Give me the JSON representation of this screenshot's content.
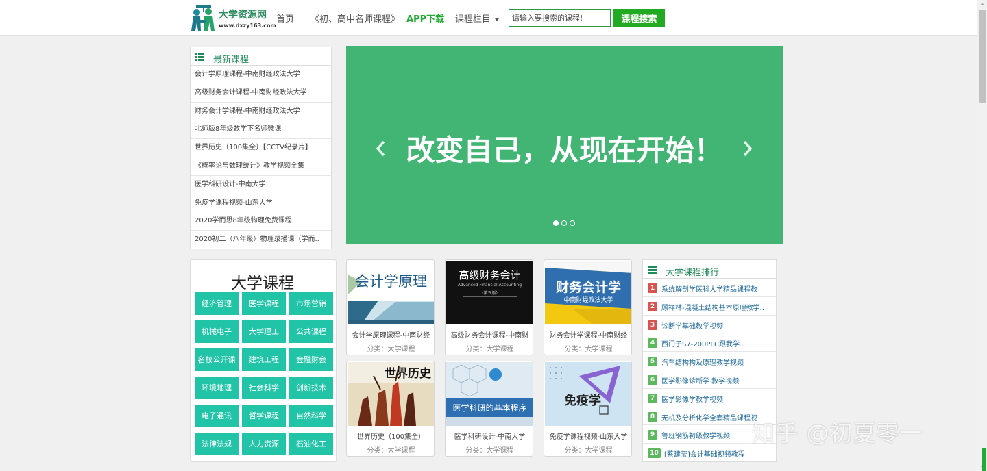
{
  "header": {
    "logo_title": "大学资源网",
    "logo_url": "www.dxzy163.com",
    "nav": {
      "home": "首页",
      "teachers": "《初、高中名师课程》",
      "app": "APP下载",
      "columns": "课程栏目"
    },
    "search_placeholder": "请输入要搜索的课程!",
    "search_button": "课程搜索"
  },
  "latest": {
    "title": "最新课程",
    "items": [
      "会计学原理课程-中南财经政法大学",
      "高级财务会计课程-中南财经政法大学",
      "财务会计学课程-中南财经政法大学",
      "北师版8年级数学下名师微课",
      "世界历史（100集全）【CCTV纪录片】",
      "《概率论与数理统计》教学视频全集",
      "医学科研设计-中南大学",
      "免疫学课程视频-山东大学",
      "2020学而思8年级物理免费课程",
      "2020初二（八年级）物理录播课（学而.."
    ]
  },
  "banner": {
    "text": "改变自己，从现在开始！",
    "color": "#42b574"
  },
  "categories": {
    "title": "大学课程",
    "items": [
      "经济管理",
      "医学课程",
      "市场营销",
      "机械电子",
      "大学理工",
      "公共课程",
      "名校公开课",
      "建筑工程",
      "金融财会",
      "环境地理",
      "社会科学",
      "创新技术",
      "电子通讯",
      "哲学课程",
      "自然科学",
      "法律法规",
      "人力资源",
      "石油化工"
    ]
  },
  "courses": [
    {
      "name": "会计学原理课程-中南财经",
      "cat": "分类：大学课程",
      "cover": "会计学原理"
    },
    {
      "name": "高级财务会计课程-中南财",
      "cat": "分类：大学课程",
      "cover": "高级财务会计",
      "cover_sub": "Advanced Financial Accounting",
      "cover_ed": "（第五版）"
    },
    {
      "name": "财务会计学课程-中南财经",
      "cat": "分类：大学课程",
      "cover": "财务会计学",
      "cover_sub": "中南财经政法大学"
    },
    {
      "name": "世界历史（100集全）",
      "cat": "分类：大学课程",
      "cover": "世界历史"
    },
    {
      "name": "医学科研设计-中南大学",
      "cat": "分类：大学课程",
      "cover": "医学科研的基本程序"
    },
    {
      "name": "免疫学课程视频-山东大学",
      "cat": "分类：大学课程",
      "cover": "免疫学"
    }
  ],
  "ranking": {
    "title": "大学课程排行",
    "items": [
      {
        "num": "1",
        "text": "系统解剖学医科大学精品课程教"
      },
      {
        "num": "2",
        "text": "顾祥林-混凝土结构基本原理教学.."
      },
      {
        "num": "3",
        "text": "诊断学基础教学视频"
      },
      {
        "num": "4",
        "text": "西门子S7-200PLC跟我学.."
      },
      {
        "num": "5",
        "text": "汽车结构构及原理教学视频"
      },
      {
        "num": "6",
        "text": "医学影像诊断学 教学视频"
      },
      {
        "num": "7",
        "text": "医学影像学教学视频"
      },
      {
        "num": "8",
        "text": "无机及分析化学全套精品课程视"
      },
      {
        "num": "9",
        "text": "鲁班钢筋初级教学视频"
      },
      {
        "num": "10",
        "text": "[蔡建莹]会计基础视频教程"
      }
    ],
    "badge_colors": {
      "top": "#d9534f",
      "rest": "#5cb85c"
    }
  },
  "watermark": "知乎 @初夏零一"
}
